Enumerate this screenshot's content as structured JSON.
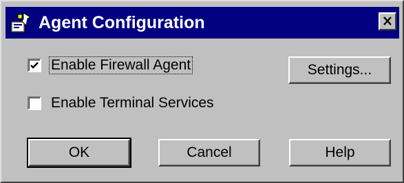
{
  "window": {
    "title": "Agent Configuration",
    "title_icon": "agent-config-icon",
    "close_icon": "close-icon"
  },
  "options": {
    "firewall": {
      "label": "Enable Firewall Agent",
      "checked": true
    },
    "terminal": {
      "label": "Enable Terminal Services",
      "checked": false
    }
  },
  "buttons": {
    "settings": "Settings...",
    "ok": "OK",
    "cancel": "Cancel",
    "help": "Help"
  },
  "colors": {
    "titlebar": "#000080",
    "face": "#c0c0c0"
  }
}
